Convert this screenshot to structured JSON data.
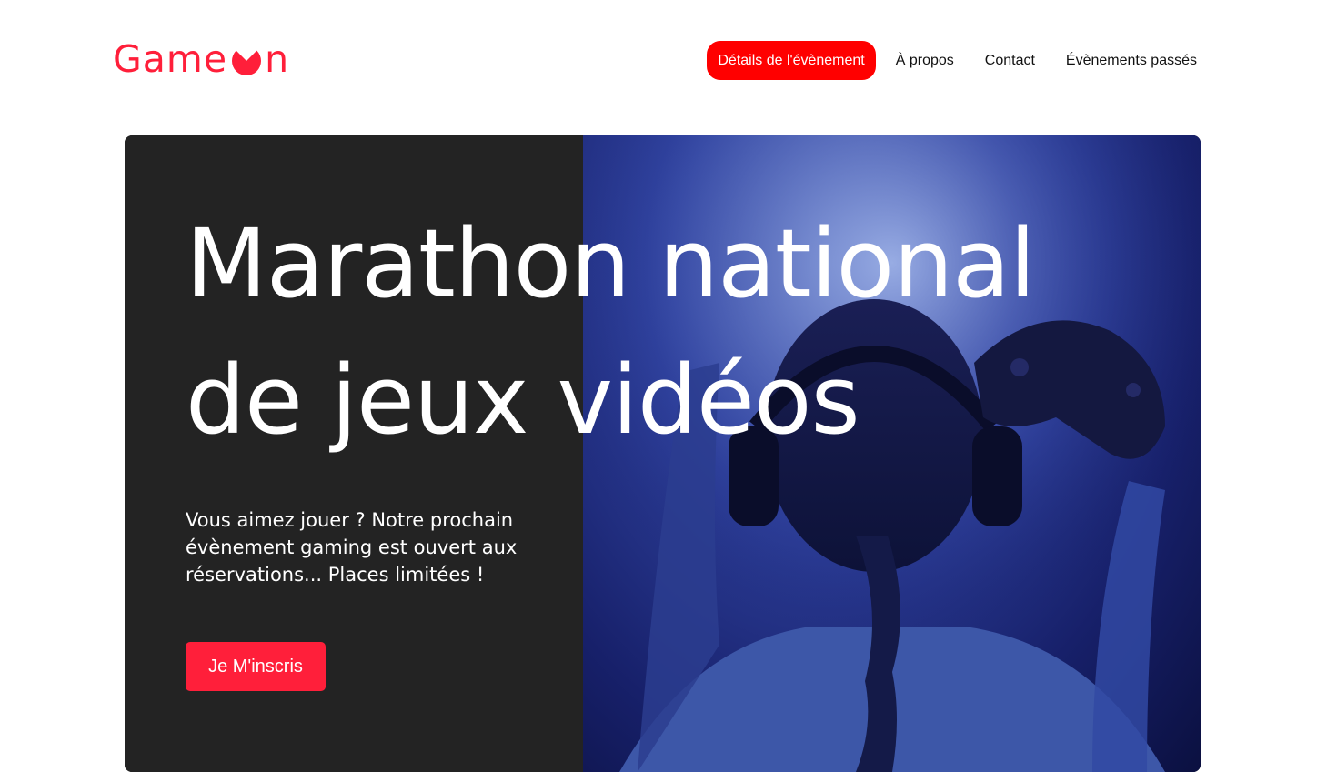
{
  "brand": {
    "logo_before": "Game",
    "logo_after": "n",
    "color": "#FF1F3A"
  },
  "nav": {
    "items": [
      {
        "label": "Détails de l'évènement",
        "active": true
      },
      {
        "label": "À propos",
        "active": false
      },
      {
        "label": "Contact",
        "active": false
      },
      {
        "label": "Évènements passés",
        "active": false
      }
    ]
  },
  "hero": {
    "title_line1": "Marathon national",
    "title_line2": "de jeux vidéos",
    "description": "Vous aimez jouer ? Notre prochain évènement gaming est ouvert aux réservations... Places limitées !",
    "cta_label": "Je M'inscris",
    "image_icon": "gamer-with-headphones-image"
  },
  "colors": {
    "accent": "#FF1F3A",
    "nav_active": "#FF0000",
    "hero_dark": "#232323"
  }
}
